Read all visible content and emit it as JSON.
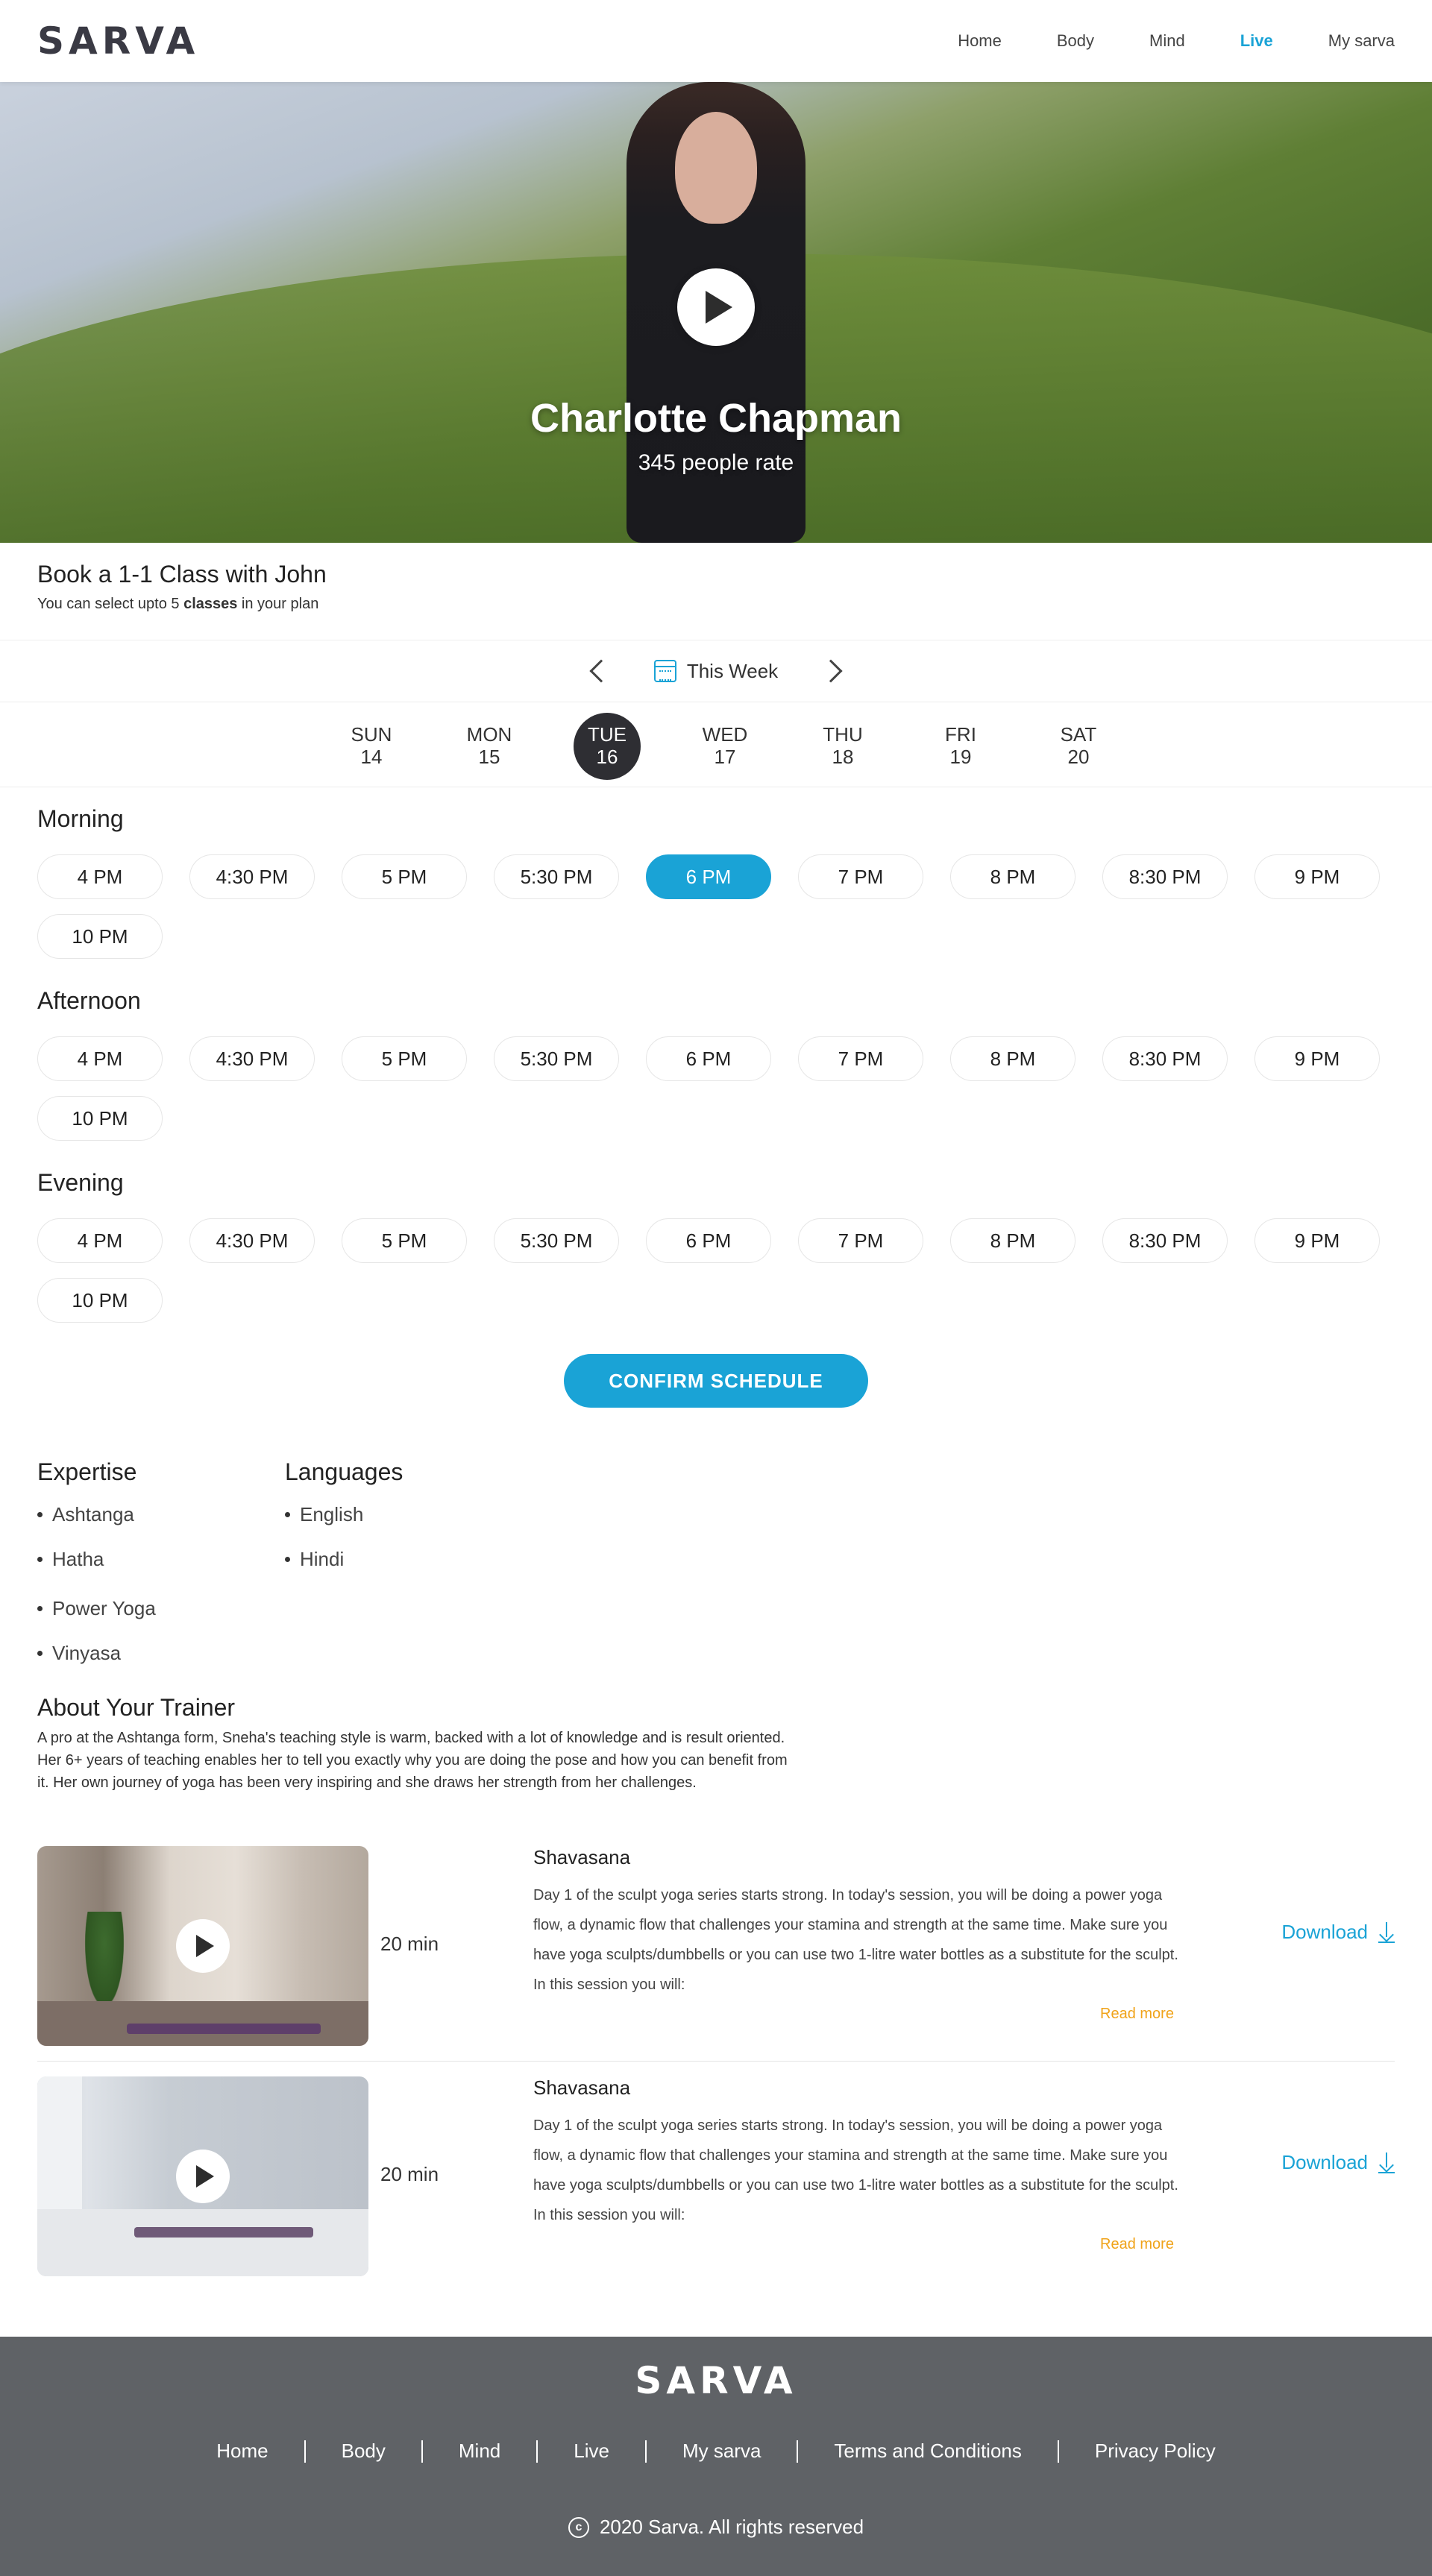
{
  "header": {
    "logo": "SARVA",
    "nav": [
      {
        "label": "Home",
        "active": false
      },
      {
        "label": "Body",
        "active": false
      },
      {
        "label": "Mind",
        "active": false
      },
      {
        "label": "Live",
        "active": true
      },
      {
        "label": "My sarva",
        "active": false
      }
    ]
  },
  "hero": {
    "title": "Charlotte Chapman",
    "subtitle": "345 people rate"
  },
  "book": {
    "title": "Book a 1-1 Class with John",
    "subtitle_pre": "You can select upto 5 ",
    "subtitle_bold": "classes",
    "subtitle_post": " in your plan"
  },
  "week": {
    "label": "This Week"
  },
  "days": [
    {
      "name": "SUN",
      "date": "14",
      "selected": false
    },
    {
      "name": "MON",
      "date": "15",
      "selected": false
    },
    {
      "name": "TUE",
      "date": "16",
      "selected": true
    },
    {
      "name": "WED",
      "date": "17",
      "selected": false
    },
    {
      "name": "THU",
      "date": "18",
      "selected": false
    },
    {
      "name": "FRI",
      "date": "19",
      "selected": false
    },
    {
      "name": "SAT",
      "date": "20",
      "selected": false
    }
  ],
  "slots": {
    "morning": {
      "title": "Morning",
      "times": [
        "4 PM",
        "4:30 PM",
        "5 PM",
        "5:30 PM",
        "6 PM",
        "7 PM",
        "8 PM",
        "8:30 PM",
        "9 PM",
        "10 PM"
      ],
      "selected": "6 PM"
    },
    "afternoon": {
      "title": "Afternoon",
      "times": [
        "4 PM",
        "4:30 PM",
        "5 PM",
        "5:30 PM",
        "6 PM",
        "7 PM",
        "8 PM",
        "8:30 PM",
        "9 PM",
        "10 PM"
      ],
      "selected": ""
    },
    "evening": {
      "title": "Evening",
      "times": [
        "4 PM",
        "4:30 PM",
        "5 PM",
        "5:30 PM",
        "6 PM",
        "7 PM",
        "8 PM",
        "8:30 PM",
        "9 PM",
        "10 PM"
      ],
      "selected": ""
    }
  },
  "confirm_label": "CONFIRM SCHEDULE",
  "expertise": {
    "title": "Expertise",
    "items": [
      "Ashtanga",
      "Hatha",
      "Power Yoga",
      "Vinyasa"
    ]
  },
  "languages": {
    "title": "Languages",
    "items": [
      "English",
      "Hindi"
    ]
  },
  "about": {
    "title": "About Your Trainer",
    "text": "A pro at the Ashtanga form, Sneha's teaching style is warm, backed with a lot of knowledge and is result oriented. Her 6+ years of teaching enables her to tell you exactly why you are doing the pose and how you can benefit from it. Her own journey of yoga has been very inspiring and she draws her strength from her challenges."
  },
  "sessions": [
    {
      "duration": "20 min",
      "title": "Shavasana",
      "description": "Day 1 of the sculpt yoga series starts strong. In today's session, you will be doing a power yoga flow, a dynamic flow that challenges your stamina and strength at the same time. Make sure you have yoga sculpts/dumbbells or you can use two 1-litre water bottles as a substitute for the sculpt. In this session you will:",
      "read_more": "Read more",
      "download": "Download"
    },
    {
      "duration": "20 min",
      "title": "Shavasana",
      "description": "Day 1 of the sculpt yoga series starts strong. In today's session, you will be doing a power yoga flow, a dynamic flow that challenges your stamina and strength at the same time. Make sure you have yoga sculpts/dumbbells or you can use two 1-litre water bottles as a substitute for the sculpt. In this session you will:",
      "read_more": "Read more",
      "download": "Download"
    }
  ],
  "footer": {
    "logo": "SARVA",
    "links": [
      "Home",
      "Body",
      "Mind",
      "Live",
      "My sarva",
      "Terms and Conditions",
      "Privacy Policy"
    ],
    "copyright": "2020 Sarva. All rights reserved"
  }
}
